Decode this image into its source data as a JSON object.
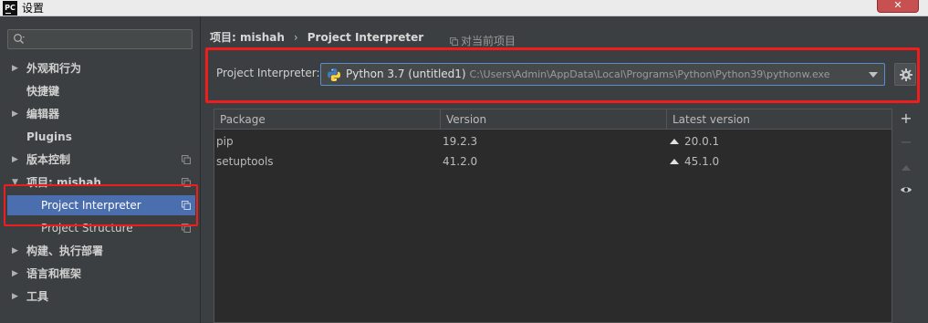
{
  "window": {
    "app_icon": "PC",
    "title": "设置",
    "close_label": "✕"
  },
  "sidebar": {
    "search_placeholder": "",
    "items": [
      {
        "label": "外观和行为",
        "has_arrow": true,
        "arrow": "▶"
      },
      {
        "label": "快捷键",
        "has_arrow": false
      },
      {
        "label": "编辑器",
        "has_arrow": true,
        "arrow": "▶"
      },
      {
        "label": "Plugins",
        "has_arrow": false
      },
      {
        "label": "版本控制",
        "has_arrow": true,
        "arrow": "▶",
        "icon": "copy-icon"
      },
      {
        "label": "项目: mishah",
        "has_arrow": true,
        "arrow": "▼",
        "icon": "copy-icon"
      },
      {
        "label": "Project Interpreter",
        "sub": true,
        "selected": true,
        "icon": "copy-icon"
      },
      {
        "label": "Project Structure",
        "sub": true,
        "icon": "copy-icon"
      },
      {
        "label": "构建、执行部署",
        "has_arrow": true,
        "arrow": "▶"
      },
      {
        "label": "语言和框架",
        "has_arrow": true,
        "arrow": "▶"
      },
      {
        "label": "工具",
        "has_arrow": true,
        "arrow": "▶"
      }
    ]
  },
  "main": {
    "breadcrumb": {
      "project": "项目: mishah",
      "separator": "›",
      "page": "Project Interpreter"
    },
    "scope_label": "对当前项目",
    "interpreter": {
      "label": "Project Interpreter:",
      "name": "Python 3.7 (untitled1)",
      "path": "C:\\Users\\Admin\\AppData\\Local\\Programs\\Python\\Python39\\pythonw.exe"
    },
    "table": {
      "columns": [
        "Package",
        "Version",
        "Latest version"
      ],
      "rows": [
        {
          "package": "pip",
          "version": "19.2.3",
          "latest": "20.0.1"
        },
        {
          "package": "setuptools",
          "version": "41.2.0",
          "latest": "45.1.0"
        }
      ]
    },
    "tools": {
      "add": "+",
      "remove": "−"
    }
  },
  "colors": {
    "background": "#3c3f41",
    "table_bg": "#2b2b2b",
    "selection": "#4b6eaf",
    "highlight_red": "#ef1d1d",
    "focus_border": "#5a8cd0"
  }
}
